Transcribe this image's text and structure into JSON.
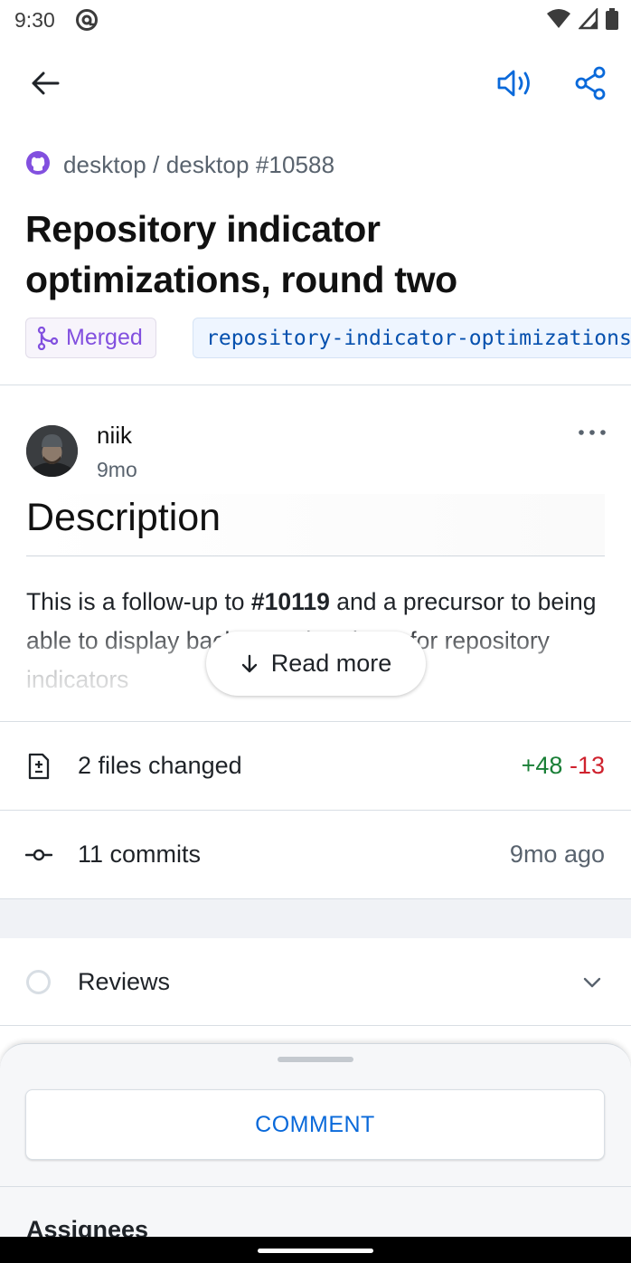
{
  "status_bar": {
    "time": "9:30",
    "icons": [
      "at-sign-notification-icon",
      "wifi-icon",
      "signal-icon",
      "battery-icon"
    ]
  },
  "app_bar": {
    "icons": [
      "back-arrow-icon",
      "speaker-icon",
      "share-icon"
    ],
    "accent_color": "#0969da"
  },
  "pr": {
    "repo_path": "desktop / desktop #10588",
    "title": "Repository indicator optimizations, round two",
    "state": "Merged",
    "state_color": "#8250df",
    "branch": "repository-indicator-optimizations-round-two"
  },
  "comment": {
    "author": "niik",
    "time": "9mo",
    "heading": "Description",
    "body_prefix": "This is a follow-up to ",
    "body_ref": "#10119",
    "body_suffix": " and a precursor to being able to display background updates for repository indicators",
    "read_more": "Read more"
  },
  "stats": {
    "files_changed": "2 files changed",
    "additions": "+48",
    "deletions": "-13",
    "commits": "11 commits",
    "commits_time": "9mo ago"
  },
  "reviews": {
    "label": "Reviews"
  },
  "sheet": {
    "comment_button": "COMMENT",
    "assignees": "Assignees"
  }
}
